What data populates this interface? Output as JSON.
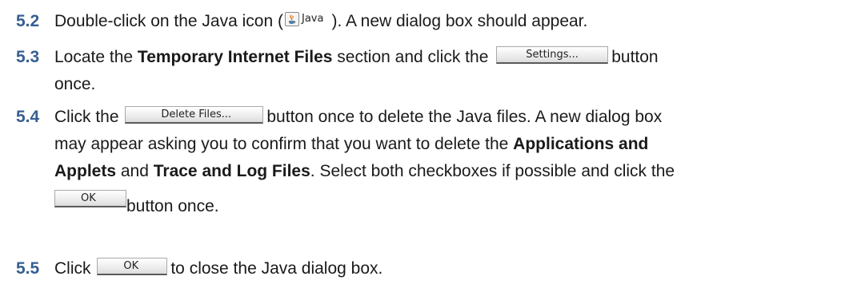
{
  "steps": [
    {
      "number": "5.2",
      "text_before": "Double-click on the Java icon (",
      "java_label": "Java",
      "text_after": "). A new dialog box should appear."
    },
    {
      "number": "5.3",
      "text_before": "Locate the ",
      "bold1": "Temporary Internet Files",
      "text_mid": " section and click the",
      "button": "Settings...",
      "text_after": "button",
      "line2": "once."
    },
    {
      "number": "5.4",
      "text_before": "Click the",
      "button": "Delete Files...",
      "text_after": "button once to delete the Java files. A new dialog box",
      "line2_before": "may appear asking you to confirm that you want to delete the ",
      "bold1": "Applications and",
      "bold2": "Applets",
      "text_and": " and ",
      "bold3": "Trace and Log Files",
      "line3_after": ". Select both checkboxes if possible and click the",
      "ok_button": "OK",
      "line4": "button once."
    },
    {
      "number": "5.5",
      "text_before": "Click",
      "button": "OK",
      "text_after": "to close the Java dialog box."
    }
  ]
}
